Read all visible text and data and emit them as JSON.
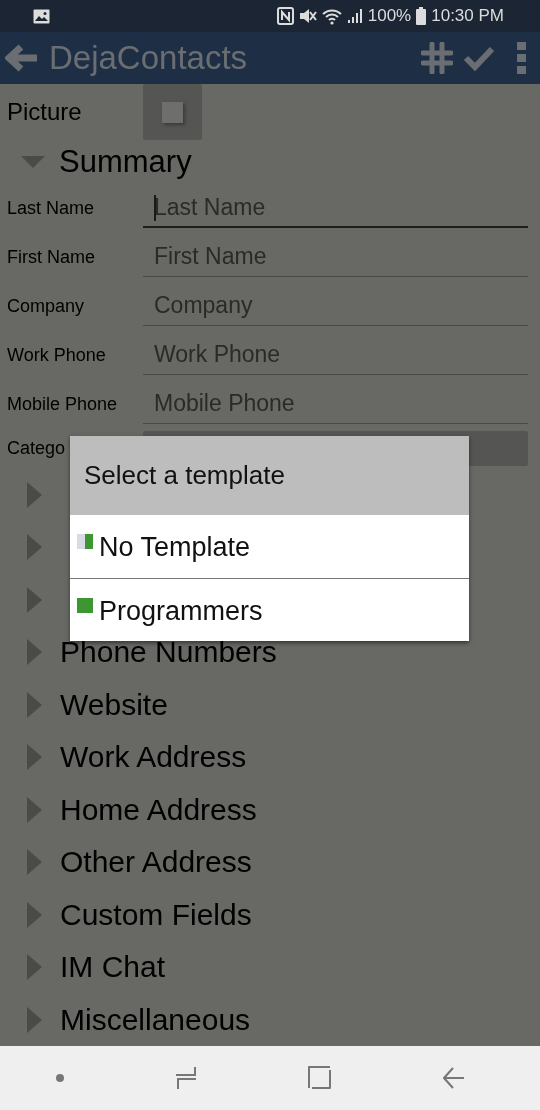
{
  "status_bar": {
    "battery": "100%",
    "time": "10:30 PM"
  },
  "app_bar": {
    "title": "DejaContacts"
  },
  "picture": {
    "label": "Picture"
  },
  "summary": {
    "label": "Summary",
    "expanded": true
  },
  "fields": [
    {
      "label": "Last Name",
      "placeholder": "Last Name",
      "focused": true
    },
    {
      "label": "First Name",
      "placeholder": "First Name",
      "focused": false
    },
    {
      "label": "Company",
      "placeholder": "Company",
      "focused": false
    },
    {
      "label": "Work Phone",
      "placeholder": "Work Phone",
      "focused": false
    },
    {
      "label": "Mobile Phone",
      "placeholder": "Mobile Phone",
      "focused": false
    }
  ],
  "category": {
    "label": "Catego"
  },
  "sections": [
    {
      "expanded": false
    },
    {
      "expanded": false
    },
    {
      "expanded": false
    },
    {
      "label": "Phone Numbers",
      "expanded": false
    },
    {
      "label": "Website",
      "expanded": false
    },
    {
      "label": "Work Address",
      "expanded": false
    },
    {
      "label": "Home Address",
      "expanded": false
    },
    {
      "label": "Other Address",
      "expanded": false
    },
    {
      "label": "Custom Fields",
      "expanded": false
    },
    {
      "label": "IM Chat",
      "expanded": false
    },
    {
      "label": "Miscellaneous",
      "expanded": false
    }
  ],
  "dialog": {
    "title": "Select a template",
    "items": [
      {
        "label": "No Template",
        "kind": "partial",
        "color": "#3d9632"
      },
      {
        "label": "Programmers",
        "kind": "full",
        "color": "#3d9632"
      }
    ]
  }
}
